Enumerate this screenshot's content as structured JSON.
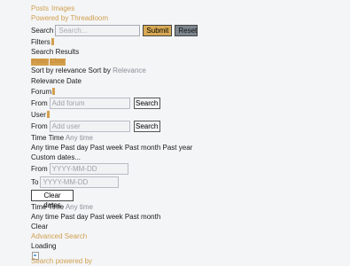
{
  "tabs": [
    "Posts",
    "Images"
  ],
  "powered_by_prefix": "Powered by",
  "powered_by_brand": "Threadloom",
  "search": {
    "label": "Search",
    "placeholder": "Search...",
    "submit_label": "Submit",
    "reset_label": "Reset"
  },
  "filters_label": "Filters",
  "search_results_label": "Search Results",
  "pills": [
    "Posts",
    "Clear"
  ],
  "sort": {
    "text": "Sort by relevance",
    "by_label": "Sort by",
    "current": "Relevance",
    "options_text": "Relevance Date"
  },
  "forum": {
    "label": "Forum",
    "from_label": "From",
    "placeholder": "Add forum",
    "button_label": "Search"
  },
  "user": {
    "label": "User",
    "from_label": "From",
    "placeholder": "Add user",
    "button_label": "Search"
  },
  "time1": {
    "label": "Time",
    "inner_label": "Time",
    "value": "Any time",
    "options_text": "Any time Past day Past week Past month Past year",
    "custom_dates": "Custom dates...",
    "from_label": "From",
    "to_label": "To",
    "date_placeholder": "YYYY-MM-DD",
    "clear_label": "Clear dates"
  },
  "time2": {
    "label": "Time",
    "inner_label": "Time",
    "value": "Any time",
    "options_text": "Any time Past day Past week Past month",
    "clear": "Clear"
  },
  "advanced_search": "Advanced Search",
  "loading": "Loading",
  "footer": "Search powered by",
  "colors": {
    "accent": "#d4a04e",
    "submit_bg": "#d8aa55",
    "reset_bg": "#7e8790",
    "page_bg": "#f4f5f7"
  }
}
